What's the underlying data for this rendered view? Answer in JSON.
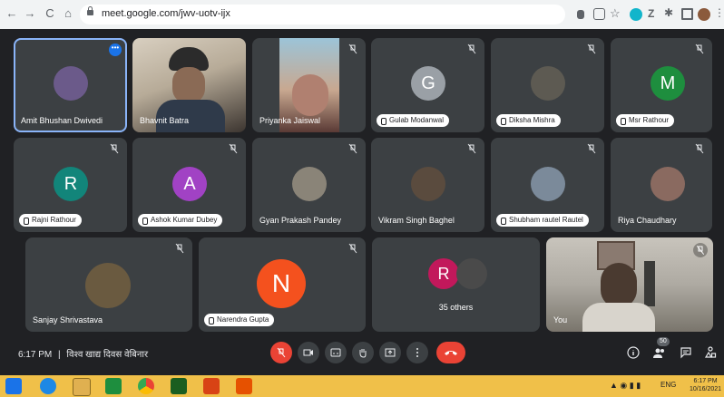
{
  "browser": {
    "url": "meet.google.com/jwv-uotv-ijx",
    "nav_back": "←",
    "nav_forward": "→",
    "nav_reload": "C",
    "nav_home": "⌂"
  },
  "participants": [
    {
      "name": "Amit Bhushan Dwivedi",
      "style": "plain",
      "muted": false,
      "speaking": true,
      "more": "•••",
      "avatar_type": "photo",
      "avatar_color": "#6b5a8a"
    },
    {
      "name": "Bhavnit Batra",
      "style": "plain",
      "muted": false,
      "avatar_type": "video"
    },
    {
      "name": "Priyanka Jaiswal",
      "style": "plain",
      "muted": true,
      "avatar_type": "video"
    },
    {
      "name": "Gulab Modanwal",
      "style": "pill",
      "muted": true,
      "avatar_type": "letter",
      "letter": "G",
      "avatar_color": "#9aa0a6"
    },
    {
      "name": "Diksha Mishra",
      "style": "pill",
      "muted": true,
      "avatar_type": "photo",
      "avatar_color": "#5d5a52"
    },
    {
      "name": "Msr Rathour",
      "style": "pill",
      "muted": true,
      "avatar_type": "letter",
      "letter": "M",
      "avatar_color": "#1e8e3e"
    },
    {
      "name": "Rajni Rathour",
      "style": "pill",
      "muted": true,
      "avatar_type": "letter",
      "letter": "R",
      "avatar_color": "#12857a"
    },
    {
      "name": "Ashok Kumar Dubey",
      "style": "pill",
      "muted": true,
      "avatar_type": "letter",
      "letter": "A",
      "avatar_color": "#a142c4"
    },
    {
      "name": "Gyan Prakash Pandey",
      "style": "plain",
      "muted": true,
      "avatar_type": "photo",
      "avatar_color": "#8a8478"
    },
    {
      "name": "Vikram Singh Baghel",
      "style": "plain",
      "muted": true,
      "avatar_type": "photo",
      "avatar_color": "#5a4b3e"
    },
    {
      "name": "Shubham rautel Rautel",
      "style": "pill",
      "muted": true,
      "avatar_type": "photo",
      "avatar_color": "#7b8a9a"
    },
    {
      "name": "Riya Chaudhary",
      "style": "plain",
      "muted": true,
      "avatar_type": "photo",
      "avatar_color": "#8a6a60"
    },
    {
      "name": "Sanjay Shrivastava",
      "style": "plain",
      "muted": true,
      "avatar_type": "photo",
      "avatar_color": "#6a5a40"
    },
    {
      "name": "Narendra Gupta",
      "style": "pill",
      "muted": true,
      "avatar_type": "letter",
      "letter": "N",
      "avatar_color": "#f4511e"
    },
    {
      "name": "35 others",
      "style": "center",
      "muted": false,
      "avatar_type": "group",
      "letter": "R",
      "avatar_color": "#c2185b"
    },
    {
      "name": "You",
      "style": "plain",
      "muted": true,
      "avatar_type": "video"
    }
  ],
  "controls": {
    "meeting_time": "6:17 PM",
    "separator": "|",
    "meeting_title": "विश्व खाद्य दिवस वेबिनार",
    "participant_badge": "50"
  },
  "taskbar": {
    "lang": "ENG",
    "clock_time": "6:17 PM",
    "clock_date": "10/16/2021"
  },
  "colors": {
    "accent": "#1a73e8",
    "hangup": "#ea4335",
    "tile_bg": "#3c4043",
    "stage_bg": "#202124",
    "taskbar": "#f0c049"
  }
}
